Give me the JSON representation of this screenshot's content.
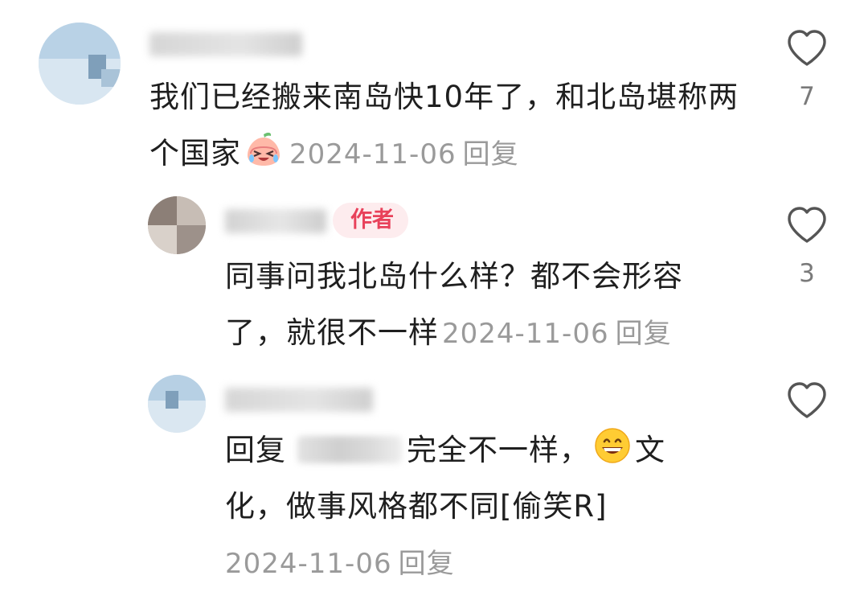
{
  "comments": [
    {
      "body_text": "我们已经搬来南岛快10年了，和北岛堪称两个国家",
      "date": "2024-11-06",
      "reply_label": "回复",
      "like_count": "7",
      "emoji_icon": "crying-laughing-peach-emoji-icon"
    },
    {
      "author_badge": "作者",
      "body_text": "同事问我北岛什么样？都不会形容了，就很不一样",
      "date": "2024-11-06",
      "reply_label": "回复",
      "like_count": "3"
    },
    {
      "reply_prefix": "回复",
      "body_before_emoji": "完全不一样，",
      "emoji_icon": "grinning-face-emoji-icon",
      "body_after_emoji": "文化，做事风格都不同[偷笑R]",
      "date": "2024-11-06",
      "reply_label": "回复"
    }
  ],
  "colors": {
    "body_text": "#1f1f1f",
    "meta_text": "#9a9a9a",
    "author_badge_bg": "#fdecee",
    "author_badge_text": "#e8415a",
    "like_icon": "#555555"
  }
}
